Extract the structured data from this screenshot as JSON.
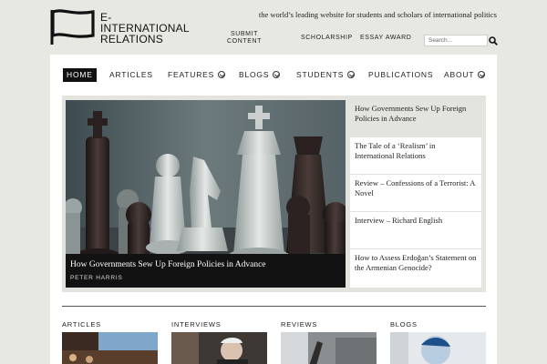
{
  "brand": {
    "name_line1": "E-INTERNATIONAL",
    "name_line2": "RELATIONS",
    "tagline": "the world’s leading website for students and scholars of international politics"
  },
  "utility_nav": {
    "submit_line1": "SUBMIT",
    "submit_line2": "CONTENT",
    "scholarship": "SCHOLARSHIP",
    "essay_award": "ESSAY AWARD",
    "search_placeholder": "Search..."
  },
  "main_nav": [
    {
      "label": "HOME",
      "active": true
    },
    {
      "label": "ARTICLES"
    },
    {
      "label": "FEATURES",
      "dropdown": true
    },
    {
      "label": "BLOGS",
      "dropdown": true
    },
    {
      "label": "STUDENTS",
      "dropdown": true
    },
    {
      "label": "PUBLICATIONS"
    },
    {
      "label": "ABOUT",
      "dropdown": true
    }
  ],
  "featured": {
    "title": "How Governments Sew Up Foreign Policies in Advance",
    "author": "PETER HARRIS"
  },
  "side_list": [
    "How Governments Sew Up Foreign Policies in Advance",
    "The Tale of a ‘Realism’ in International Relations",
    "Review – Confessions of a Terrorist: A Novel",
    "Interview – Richard English",
    "How to Assess Erdoğan’s Statement on the Armenian Genocide?"
  ],
  "sections": [
    "ARTICLES",
    "INTERVIEWS",
    "REVIEWS",
    "BLOGS"
  ],
  "colors": {
    "background": "#e8e8e3",
    "panel": "#ffffff",
    "nav_active": "#111111",
    "caption_bar": "#121212"
  }
}
